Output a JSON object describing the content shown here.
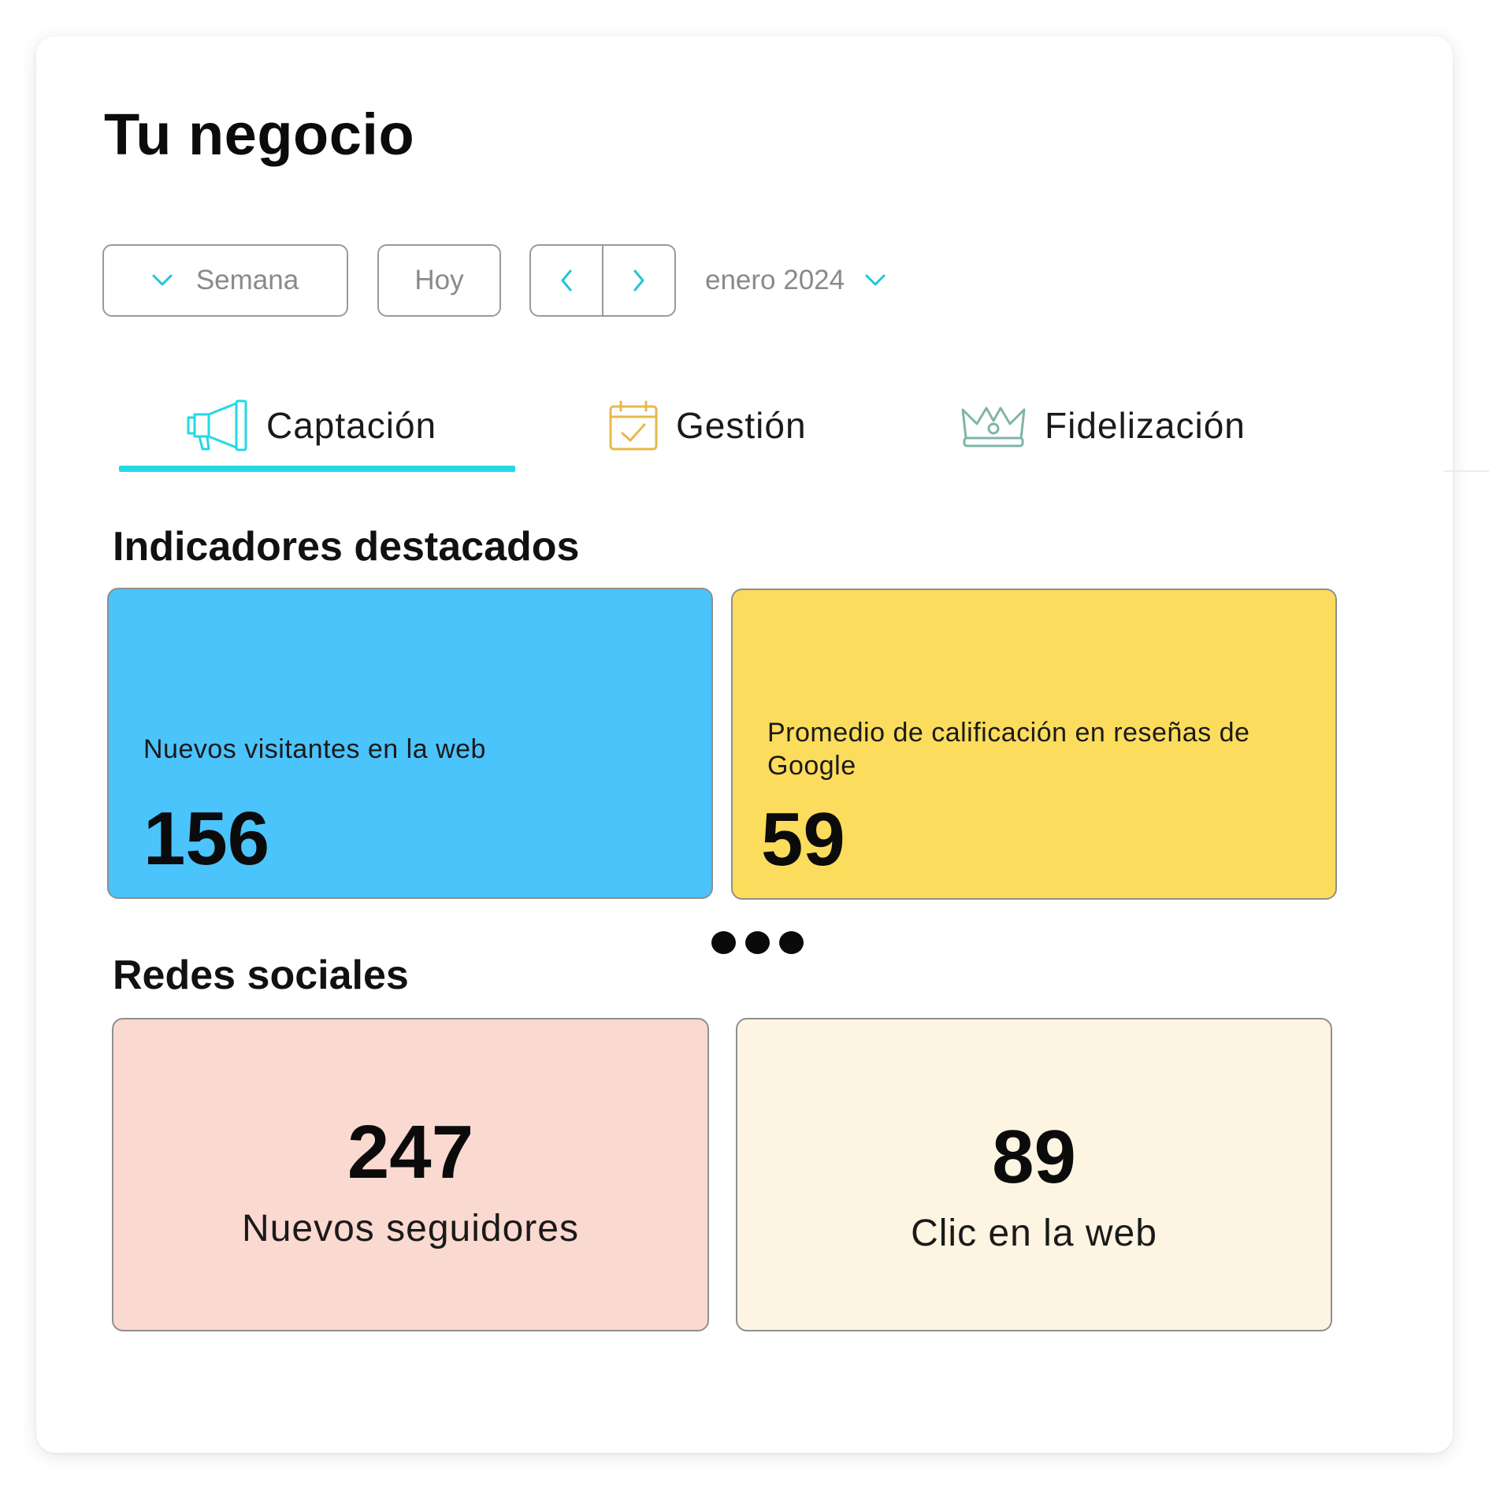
{
  "page": {
    "title": "Tu negocio"
  },
  "toolbar": {
    "period_label": "Semana",
    "today_label": "Hoy",
    "month_label": "enero 2024"
  },
  "tabs": [
    {
      "label": "Captación",
      "icon": "megaphone-icon",
      "active": true
    },
    {
      "label": "Gestión",
      "icon": "calendar-check-icon",
      "active": false
    },
    {
      "label": "Fidelización",
      "icon": "crown-icon",
      "active": false
    }
  ],
  "highlights": {
    "title": "Indicadores destacados",
    "cards": [
      {
        "label": "Nuevos visitantes en la web",
        "value": "156",
        "color": "#4bc3fb"
      },
      {
        "label": "Promedio de calificación en reseñas de Google",
        "value": "59",
        "color": "#fcdc5c"
      }
    ]
  },
  "social": {
    "title": "Redes sociales",
    "cards": [
      {
        "value": "247",
        "label": "Nuevos seguidores",
        "color": "#fad9d0"
      },
      {
        "value": "89",
        "label": "Clic en la web",
        "color": "#fef4e2"
      }
    ]
  },
  "colors": {
    "accent": "#22d9e6",
    "tab_icon_captacion": "#22d9e6",
    "tab_icon_gestion": "#e8b84a",
    "tab_icon_fidelizacion": "#7fb5a8"
  }
}
